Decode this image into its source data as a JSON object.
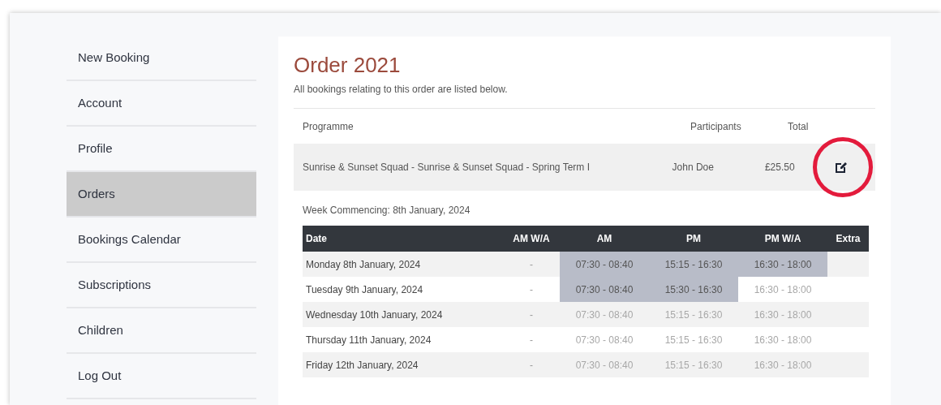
{
  "sidebar": {
    "items": [
      {
        "label": "New Booking",
        "selected": false
      },
      {
        "label": "Account",
        "selected": false
      },
      {
        "label": "Profile",
        "selected": false
      },
      {
        "label": "Orders",
        "selected": true
      },
      {
        "label": "Bookings Calendar",
        "selected": false
      },
      {
        "label": "Subscriptions",
        "selected": false
      },
      {
        "label": "Children",
        "selected": false
      },
      {
        "label": "Log Out",
        "selected": false
      }
    ]
  },
  "order": {
    "title": "Order 2021",
    "description": "All bookings relating to this order are listed below.",
    "columns": [
      "Programme",
      "Participants",
      "Total"
    ],
    "bookings": [
      {
        "programme": "Sunrise & Sunset Squad - Sunrise & Sunset Squad - Spring Term I",
        "participants": "John Doe",
        "total": "£25.50",
        "edit_circled": true
      }
    ]
  },
  "week": {
    "label": "Week Commencing: 8th January, 2024",
    "columns": [
      "Date",
      "AM W/A",
      "AM",
      "PM",
      "PM W/A",
      "Extra"
    ],
    "rows": [
      {
        "date": "Monday 8th January, 2024",
        "am_wa": "-",
        "slots": [
          {
            "time": "07:30 - 08:40",
            "booked": true
          },
          {
            "time": "15:15 - 16:30",
            "booked": true
          },
          {
            "time": "16:30 - 18:00",
            "booked": true
          }
        ]
      },
      {
        "date": "Tuesday 9th January, 2024",
        "am_wa": "-",
        "slots": [
          {
            "time": "07:30 - 08:40",
            "booked": true
          },
          {
            "time": "15:30 - 16:30",
            "booked": true
          },
          {
            "time": "16:30 - 18:00",
            "booked": false
          }
        ]
      },
      {
        "date": "Wednesday 10th January, 2024",
        "am_wa": "-",
        "slots": [
          {
            "time": "07:30 - 08:40",
            "booked": false
          },
          {
            "time": "15:15 - 16:30",
            "booked": false
          },
          {
            "time": "16:30 - 18:00",
            "booked": false
          }
        ]
      },
      {
        "date": "Thursday 11th January, 2024",
        "am_wa": "-",
        "slots": [
          {
            "time": "07:30 - 08:40",
            "booked": false
          },
          {
            "time": "15:15 - 16:30",
            "booked": false
          },
          {
            "time": "16:30 - 18:00",
            "booked": false
          }
        ]
      },
      {
        "date": "Friday 12th January, 2024",
        "am_wa": "-",
        "slots": [
          {
            "time": "07:30 - 08:40",
            "booked": false
          },
          {
            "time": "15:15 - 16:30",
            "booked": false
          },
          {
            "time": "16:30 - 18:00",
            "booked": false
          }
        ]
      }
    ]
  }
}
